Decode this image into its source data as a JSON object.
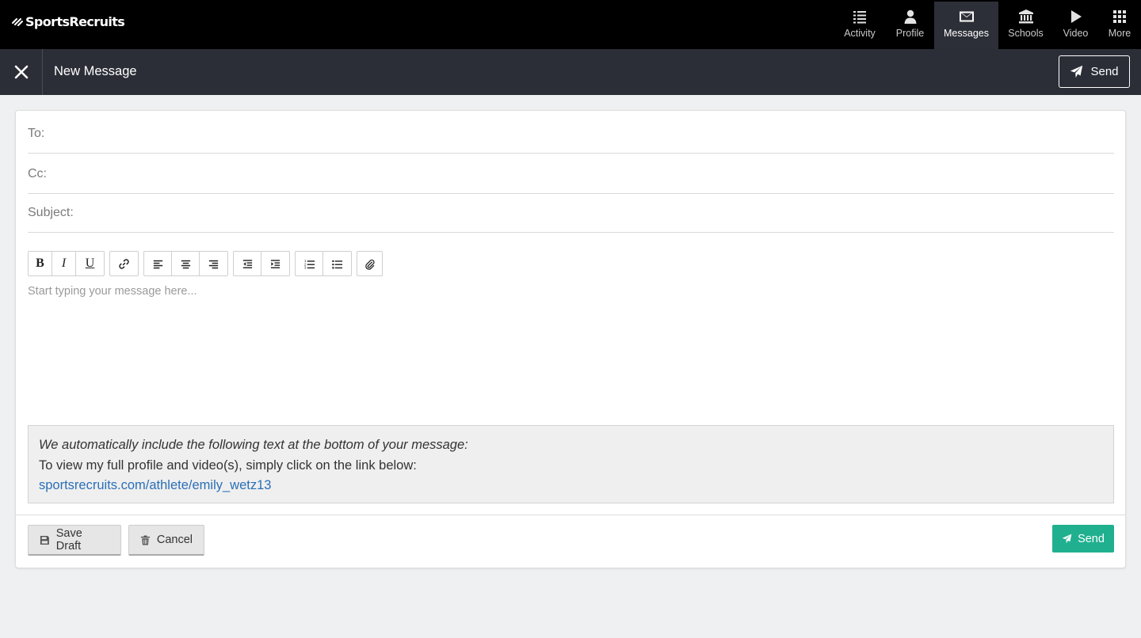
{
  "brand": {
    "name": "SportsRecruits"
  },
  "nav": {
    "items": [
      {
        "label": "Activity",
        "icon": "list-icon"
      },
      {
        "label": "Profile",
        "icon": "person-icon"
      },
      {
        "label": "Messages",
        "icon": "envelope-icon",
        "active": true
      },
      {
        "label": "Schools",
        "icon": "institution-icon"
      },
      {
        "label": "Video",
        "icon": "play-icon"
      },
      {
        "label": "More",
        "icon": "grid-icon"
      }
    ]
  },
  "header": {
    "title": "New Message",
    "send_label": "Send"
  },
  "compose": {
    "to_label": "To:",
    "to_value": "",
    "cc_label": "Cc:",
    "cc_value": "",
    "subject_label": "Subject:",
    "subject_value": "",
    "body_placeholder": "Start typing your message here..."
  },
  "toolbar": {
    "bold": "B",
    "italic": "I",
    "underline": "U"
  },
  "auto_text": {
    "intro": "We automatically include the following text at the bottom of your message:",
    "line": "To view my full profile and video(s), simply click on the link below:",
    "link": "sportsrecruits.com/athlete/emily_wetz13"
  },
  "footer": {
    "save_draft_label": "Save Draft",
    "cancel_label": "Cancel",
    "send_label": "Send"
  },
  "colors": {
    "nav_bg": "#000000",
    "subheader_bg": "#2c2e37",
    "active_nav_bg": "#2d2f38",
    "send_green": "#20b08f",
    "link_blue": "#2a6fb8"
  }
}
